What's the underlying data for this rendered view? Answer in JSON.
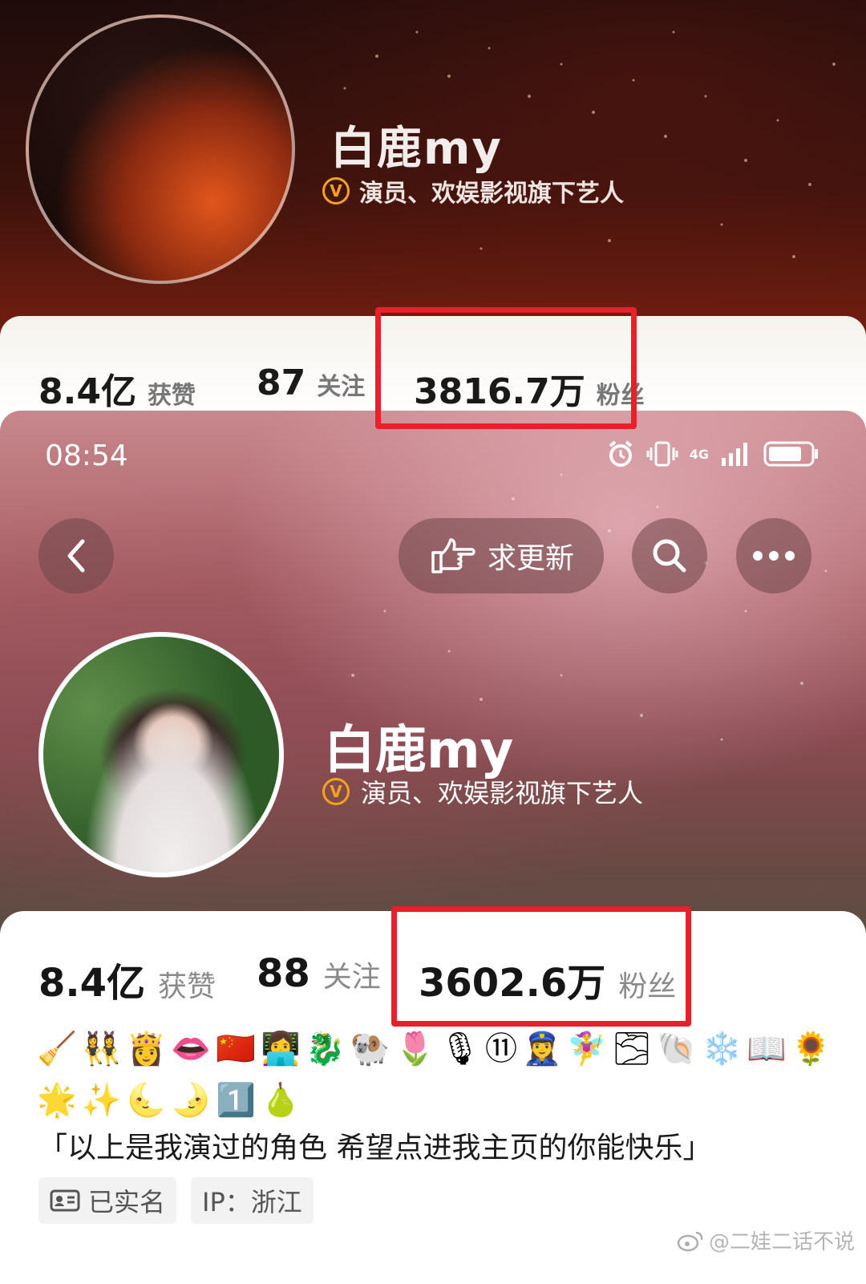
{
  "top": {
    "name": "白鹿my",
    "verify_text": "演员、欢娱影视旗下艺人",
    "verify_badge": "V",
    "stats": [
      {
        "num": "8.4亿",
        "label": "获赞"
      },
      {
        "num": "87",
        "label": "关注"
      },
      {
        "num": "3816.7万",
        "label": "粉丝"
      }
    ]
  },
  "bottom": {
    "status": {
      "time": "08:54",
      "network": "4G"
    },
    "update_label": "求更新",
    "name": "白鹿my",
    "verify_text": "演员、欢娱影视旗下艺人",
    "verify_badge": "V",
    "stats": [
      {
        "num": "8.4亿",
        "label": "获赞"
      },
      {
        "num": "88",
        "label": "关注"
      },
      {
        "num": "3602.6万",
        "label": "粉丝"
      }
    ],
    "emoji_row_1": "🧹👯‍♀️👸👄🇨🇳👩‍💻🐉🐏🌷🎙⑪👮‍♀️🧚‍♀️🌫🐚❄️📖🌻",
    "emoji_row_2": "🌟✨🌜🌛1️⃣🍐",
    "bio": "「以上是我演过的角色 希望点进我主页的你能快乐」",
    "tags": [
      "已实名",
      "IP：浙江"
    ],
    "watermark": "@二娃二话不说"
  },
  "colors": {
    "highlight": "#e8202a",
    "verify_badge": "#f3a41b"
  }
}
